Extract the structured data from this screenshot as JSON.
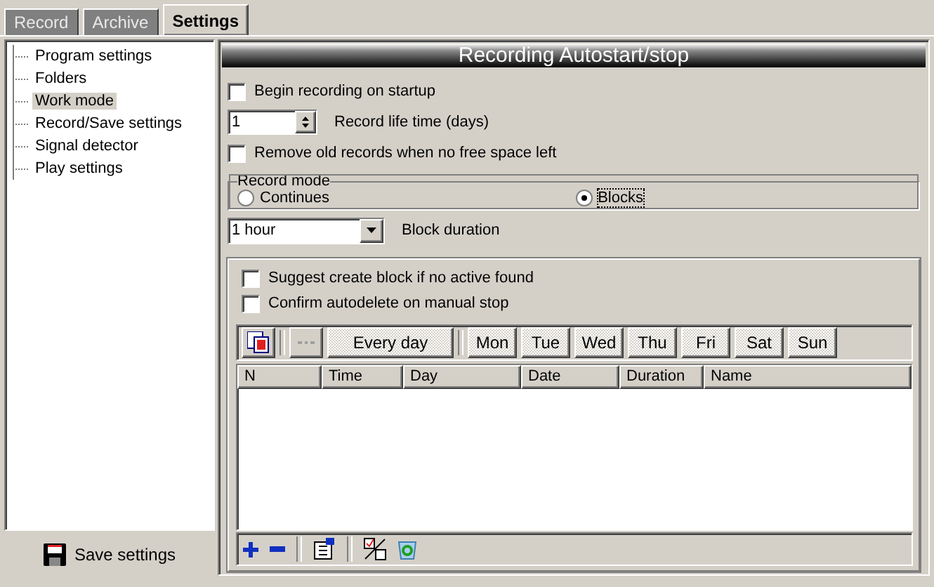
{
  "tabs": [
    {
      "label": "Record",
      "selected": false
    },
    {
      "label": "Archive",
      "selected": false
    },
    {
      "label": "Settings",
      "selected": true
    }
  ],
  "sidebar": {
    "items": [
      {
        "label": "Program settings",
        "selected": false
      },
      {
        "label": "Folders",
        "selected": false
      },
      {
        "label": "Work mode",
        "selected": true
      },
      {
        "label": "Record/Save settings",
        "selected": false
      },
      {
        "label": "Signal detector",
        "selected": false
      },
      {
        "label": "Play settings",
        "selected": false
      }
    ],
    "save_button": "Save settings"
  },
  "panel": {
    "title": "Recording Autostart/stop",
    "begin_on_startup": {
      "label": "Begin recording on startup",
      "checked": false
    },
    "life_time": {
      "value": "1",
      "label": "Record life time (days)"
    },
    "remove_old": {
      "label": "Remove old records when no free space left",
      "checked": false
    },
    "record_mode": {
      "title": "Record mode",
      "options": [
        {
          "label": "Continues",
          "selected": false
        },
        {
          "label": "Blocks",
          "selected": true
        }
      ]
    },
    "block_duration": {
      "value": "1 hour",
      "label": "Block duration"
    },
    "suggest_create": {
      "label": "Suggest create block if no active found",
      "checked": false
    },
    "confirm_autodelete": {
      "label": "Confirm autodelete on manual stop",
      "checked": false
    },
    "schedule_buttons": [
      {
        "label": "Every day",
        "pressed": true
      }
    ],
    "day_buttons": [
      {
        "label": "Mon",
        "pressed": true
      },
      {
        "label": "Tue",
        "pressed": true
      },
      {
        "label": "Wed",
        "pressed": true
      },
      {
        "label": "Thu",
        "pressed": true
      },
      {
        "label": "Fri",
        "pressed": true
      },
      {
        "label": "Sat",
        "pressed": true
      },
      {
        "label": "Sun",
        "pressed": true
      }
    ],
    "table": {
      "columns": [
        "N",
        "Time",
        "Day",
        "Date",
        "Duration",
        "Name"
      ]
    }
  }
}
